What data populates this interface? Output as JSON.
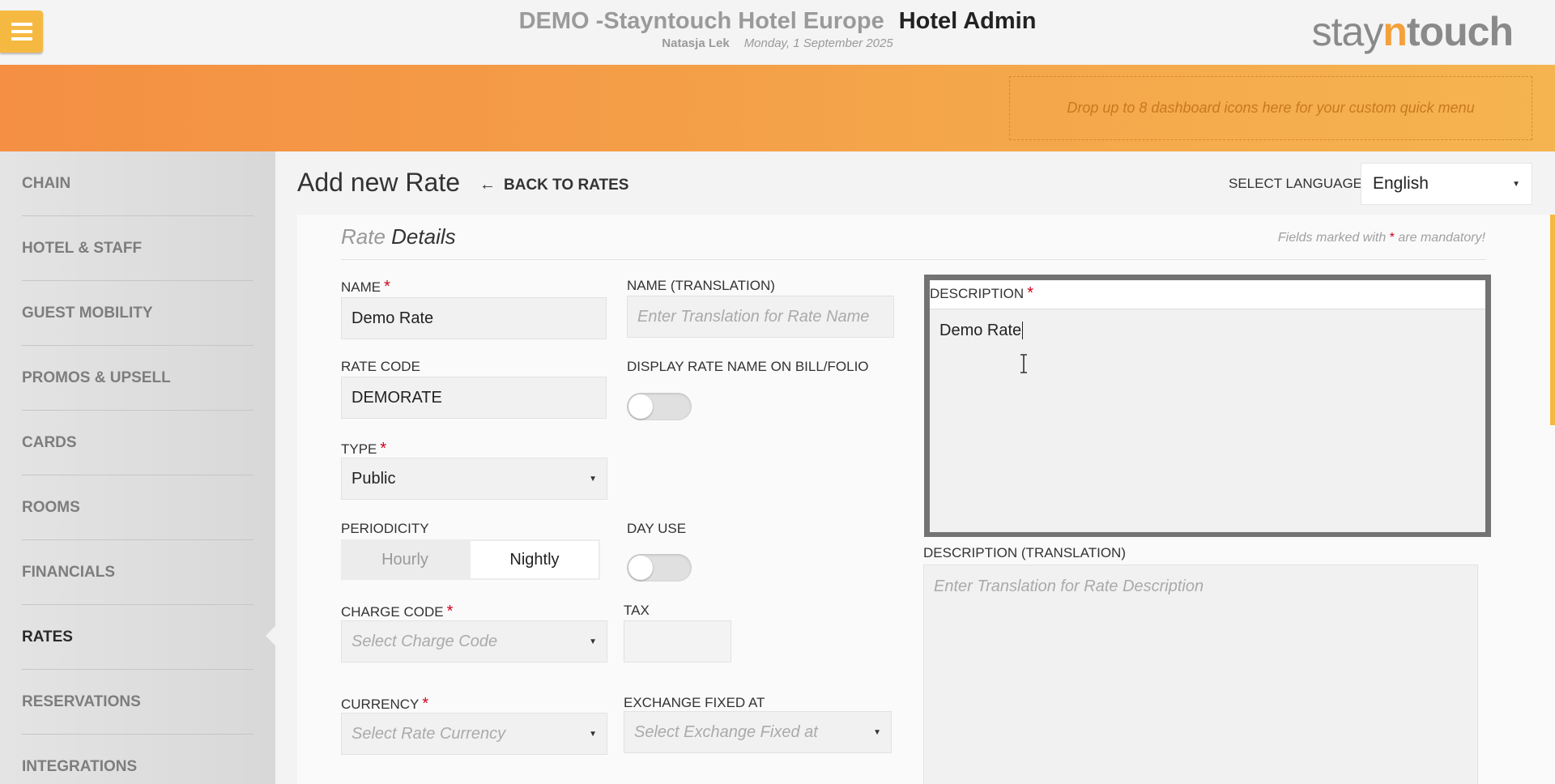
{
  "header": {
    "hotel_name": "DEMO -Stayntouch Hotel Europe",
    "app_name": "Hotel Admin",
    "user": "Natasja Lek",
    "date": "Monday, 1 September 2025",
    "logo_a": "stay",
    "logo_b": "n",
    "logo_c": "touch"
  },
  "banner": {
    "dropzone_text": "Drop up to 8 dashboard icons here for your custom quick menu"
  },
  "sidebar": {
    "items": [
      {
        "label": "CHAIN"
      },
      {
        "label": "HOTEL & STAFF"
      },
      {
        "label": "GUEST MOBILITY"
      },
      {
        "label": "PROMOS & UPSELL"
      },
      {
        "label": "CARDS"
      },
      {
        "label": "ROOMS"
      },
      {
        "label": "FINANCIALS"
      },
      {
        "label": "RATES"
      },
      {
        "label": "RESERVATIONS"
      },
      {
        "label": "INTEGRATIONS"
      }
    ],
    "active": "RATES"
  },
  "page": {
    "title": "Add new Rate",
    "back_label": "BACK TO RATES",
    "language_label": "SELECT LANGUAGE",
    "language_value": "English"
  },
  "form": {
    "section_title_a": "Rate",
    "section_title_b": "Details",
    "mandatory_a": "Fields marked with",
    "mandatory_star": "*",
    "mandatory_b": "are mandatory!",
    "name_label": "NAME",
    "name_value": "Demo Rate",
    "name_translation_label": "NAME (TRANSLATION)",
    "name_translation_placeholder": "Enter Translation for Rate Name",
    "rate_code_label": "RATE CODE",
    "rate_code_value": "DEMORATE",
    "display_name_label": "DISPLAY RATE NAME ON BILL/FOLIO",
    "display_name_on": false,
    "type_label": "TYPE",
    "type_value": "Public",
    "periodicity_label": "PERIODICITY",
    "periodicity_options": [
      "Hourly",
      "Nightly"
    ],
    "periodicity_selected": "Nightly",
    "day_use_label": "DAY USE",
    "day_use_on": false,
    "charge_code_label": "CHARGE CODE",
    "charge_code_placeholder": "Select Charge Code",
    "tax_label": "TAX",
    "tax_value": "",
    "currency_label": "CURRENCY",
    "currency_placeholder": "Select Rate Currency",
    "exchange_label": "EXCHANGE FIXED AT",
    "exchange_placeholder": "Select Exchange Fixed at",
    "description_label": "DESCRIPTION",
    "description_value": "Demo Rate",
    "description_translation_label": "DESCRIPTION (TRANSLATION)",
    "description_translation_placeholder": "Enter Translation for Rate Description",
    "required_mark": "*"
  },
  "colors": {
    "accent": "#f5b942",
    "banner_start": "#f48f43",
    "banner_end": "#f5b44f",
    "required": "#d0021b"
  }
}
